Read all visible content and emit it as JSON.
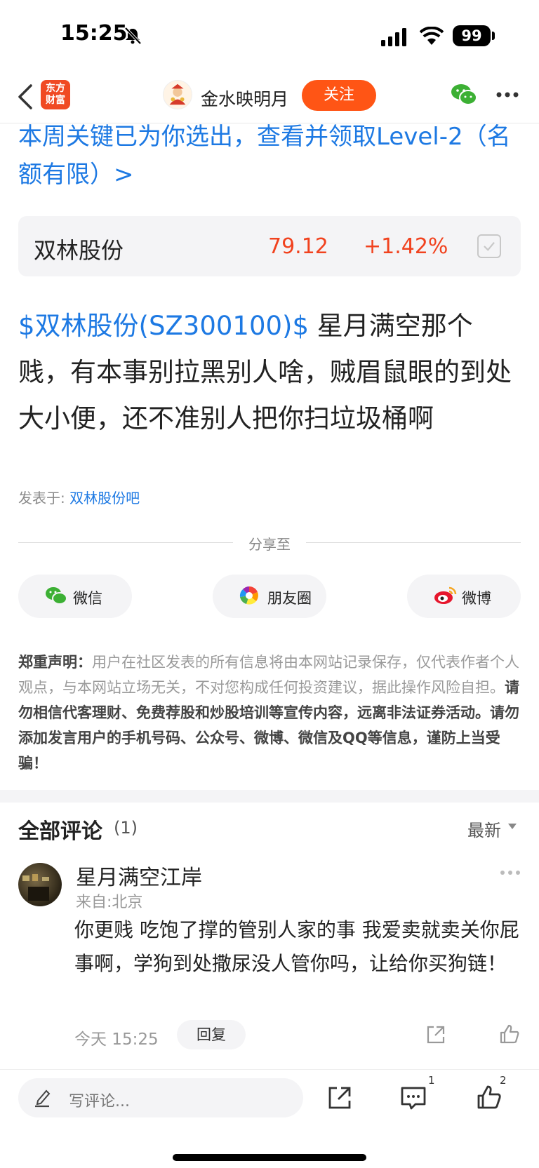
{
  "status_bar": {
    "time": "15:25",
    "battery": "99"
  },
  "nav": {
    "app_logo_line1": "东方",
    "app_logo_line2": "财富",
    "author_name": "金水映明月",
    "follow_label": "关注"
  },
  "promo": {
    "text": "本周关键已为你选出，查看并领取Level-2（名额有限）>"
  },
  "stock": {
    "name": "双林股份",
    "price": "79.12",
    "change": "+1.42%"
  },
  "post": {
    "stock_link": "$双林股份(SZ300100)$",
    "text": " 星月满空那个贱，有本事别拉黑别人啥，贼眉鼠眼的到处大小便，还不准别人把你扫垃圾桶啊",
    "posted_in_label": "发表于:",
    "posted_in_forum": "双林股份吧"
  },
  "share": {
    "title": "分享至",
    "wechat": "微信",
    "moments": "朋友圈",
    "weibo": "微博"
  },
  "disclaimer": {
    "title": "郑重声明：",
    "text1": "用户在社区发表的所有信息将由本网站记录保存，仅代表作者个人观点，与本网站立场无关，不对您构成任何投资建议，据此操作风险自担。",
    "text2": "请勿相信代客理财、免费荐股和炒股培训等宣传内容，远离非法证券活动。请勿添加发言用户的手机号码、公众号、微博、微信及QQ等信息，谨防上当受骗！"
  },
  "comments": {
    "title": "全部评论",
    "count": "(1)",
    "sort": "最新",
    "items": [
      {
        "author": "星月满空江岸",
        "location": "来自:北京",
        "text": "你更贱 吃饱了撑的管别人家的事 我爱卖就卖关你屁事啊，学狗到处撒尿没人管你吗，让给你买狗链！",
        "time": "今天 15:25",
        "reply_label": "回复"
      }
    ]
  },
  "bottom_bar": {
    "write_placeholder": "写评论...",
    "comment_count": "1",
    "like_count": "2"
  },
  "colors": {
    "accent_orange": "#ff5515",
    "link_blue": "#1d79e3",
    "price_red": "#f1421e"
  }
}
